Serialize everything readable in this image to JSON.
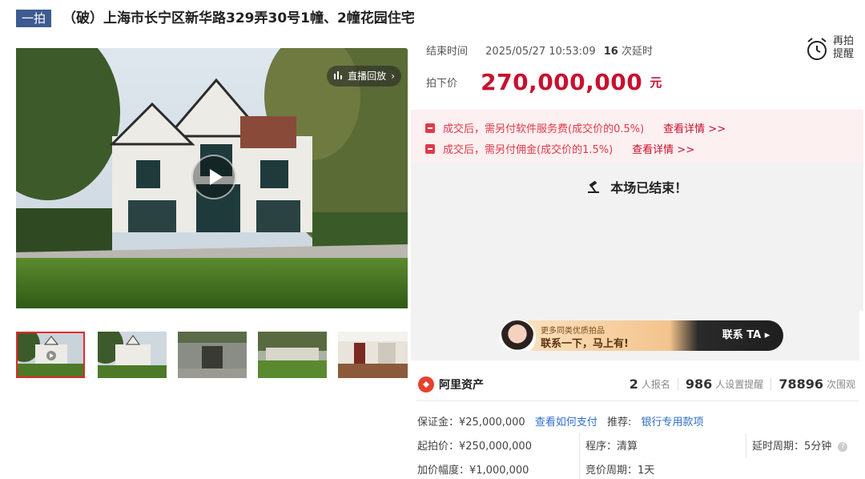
{
  "header": {
    "badge": "一拍",
    "title": "（破）上海市长宁区新华路329弄30号1幢、2幢花园住宅"
  },
  "media": {
    "live_replay_label": "直播回放",
    "thumbnails_count_visible": 5
  },
  "auction": {
    "end_time_label": "结束时间",
    "end_time_value": "2025/05/27 10:53:09",
    "extension_count": "16",
    "extension_suffix": "次延时",
    "remind_label_1": "再拍",
    "remind_label_2": "提醒",
    "price_label": "拍下价",
    "price_value": "270,000,000",
    "price_unit": "元"
  },
  "notices": [
    {
      "text": "成交后，需另付软件服务费(成交价的0.5%)",
      "link": "查看详情 >>"
    },
    {
      "text": "成交后，需另付佣金(成交价的1.5%)",
      "link": "查看详情 >>"
    }
  ],
  "status": {
    "text": "本场已结束！"
  },
  "contact": {
    "sub": "更多同类优质拍品",
    "main": "联系一下，马上有!",
    "button": "联系 TA ▸"
  },
  "brand": {
    "name": "阿里资产",
    "stats": [
      {
        "num": "2",
        "label": "人报名"
      },
      {
        "num": "986",
        "label": "人设置提醒"
      },
      {
        "num": "78896",
        "label": "次围观"
      }
    ]
  },
  "info": {
    "deposit": "保证金：¥25,000,000",
    "how_to_pay": "查看如何支付",
    "recommend_label": "推荐:",
    "recommend_value": "银行专用款项",
    "start_price": "起拍价：¥250,000,000",
    "procedure": "程序：清算",
    "delay_period": "延时周期：5分钟",
    "increment": "加价幅度：¥1,000,000",
    "bid_period": "竞价周期：1天"
  },
  "colors": {
    "badge": "#3d5c8f",
    "price": "#c8102e",
    "notice_bg": "#fdf0f0",
    "link": "#2f6ecb"
  }
}
